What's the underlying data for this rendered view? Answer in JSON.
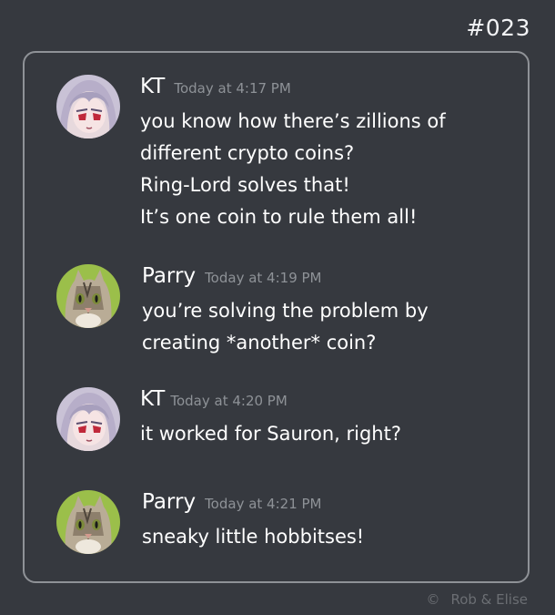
{
  "comic_number": "#023",
  "credit": {
    "symbol": "©",
    "text": "Rob & Elise"
  },
  "messages": [
    {
      "author": "KT",
      "avatar": "anime-girl-avatar-icon",
      "timestamp": "Today at 4:17 PM",
      "lines": [
        "you know how there’s zillions of",
        "different crypto coins?",
        "Ring-Lord solves that!",
        "It’s one coin to rule them all!"
      ]
    },
    {
      "author": "Parry",
      "avatar": "cat-avatar-icon",
      "timestamp": "Today at 4:19 PM",
      "lines": [
        "you’re solving the problem by",
        "creating *another* coin?"
      ]
    },
    {
      "author": "KT",
      "avatar": "anime-girl-avatar-icon",
      "timestamp": "Today at 4:20 PM",
      "lines": [
        "it worked for Sauron, right?"
      ]
    },
    {
      "author": "Parry",
      "avatar": "cat-avatar-icon",
      "timestamp": "Today at 4:21 PM",
      "lines": [
        "sneaky little hobbitses!"
      ]
    }
  ],
  "colors": {
    "background": "#36393f",
    "border": "#8f9297",
    "text": "#ffffff",
    "timestamp": "#8e9297"
  }
}
